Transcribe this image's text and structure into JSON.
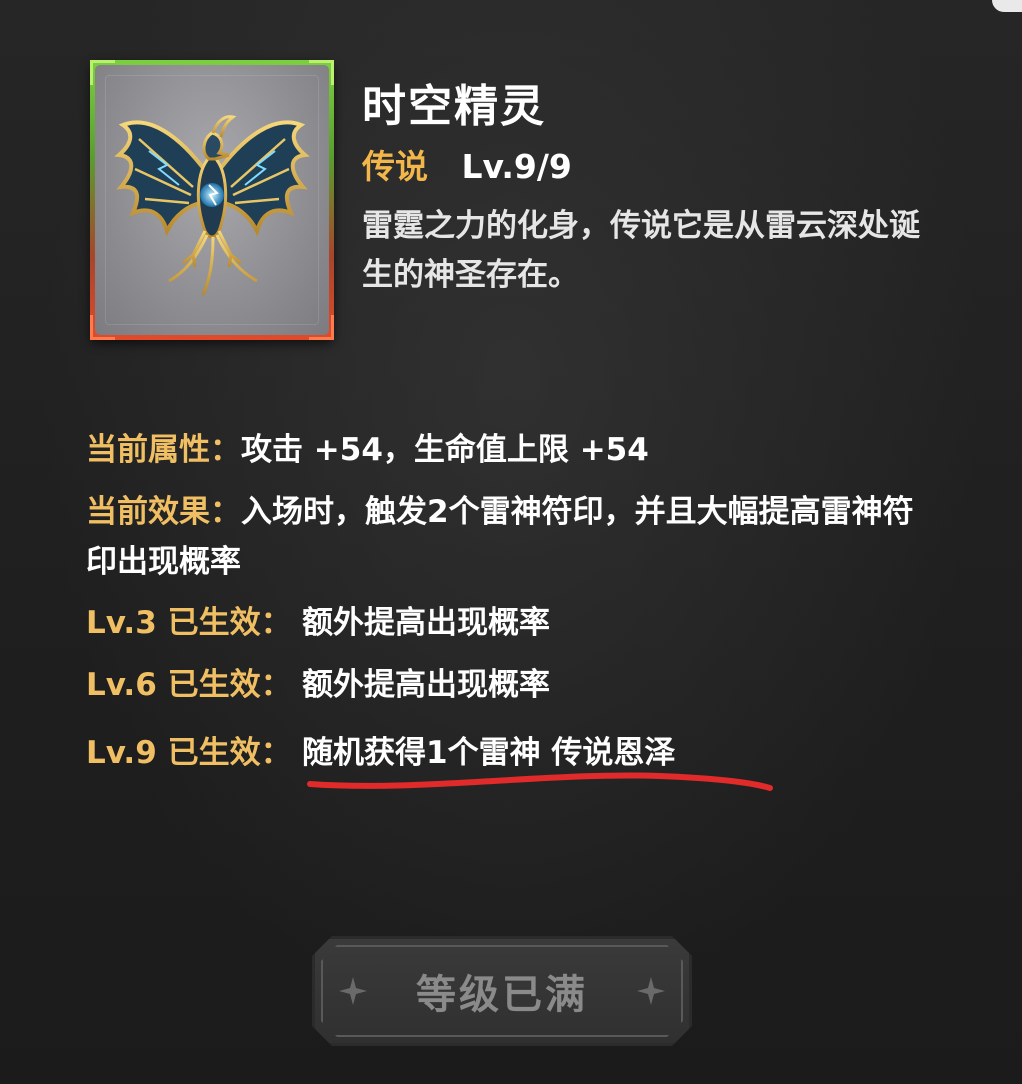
{
  "item": {
    "name": "时空精灵",
    "rarity": "传说",
    "level": "Lv.9/9",
    "description": "雷霆之力的化身，传说它是从雷云深处诞生的神圣存在。",
    "icon": "thunder-phoenix-icon"
  },
  "attributes": [
    {
      "label": "当前属性：",
      "value": "攻击 +54，生命值上限 +54"
    },
    {
      "label": "当前效果：",
      "value": "入场时，触发2个雷神符印，并且大幅提高雷神符印出现概率"
    },
    {
      "label": "Lv.3 已生效：",
      "value": "额外提高出现概率"
    },
    {
      "label": "Lv.6 已生效：",
      "value": "额外提高出现概率"
    },
    {
      "label": "Lv.9 已生效：",
      "value": "随机获得1个雷神 传说恩泽"
    }
  ],
  "button": {
    "label": "等级已满"
  },
  "colors": {
    "rarity": "#f2b64a",
    "label": "#f1bf63",
    "underline": "#e12a2a",
    "card_top": "#7ccf3f",
    "card_bottom": "#e14a2a"
  }
}
